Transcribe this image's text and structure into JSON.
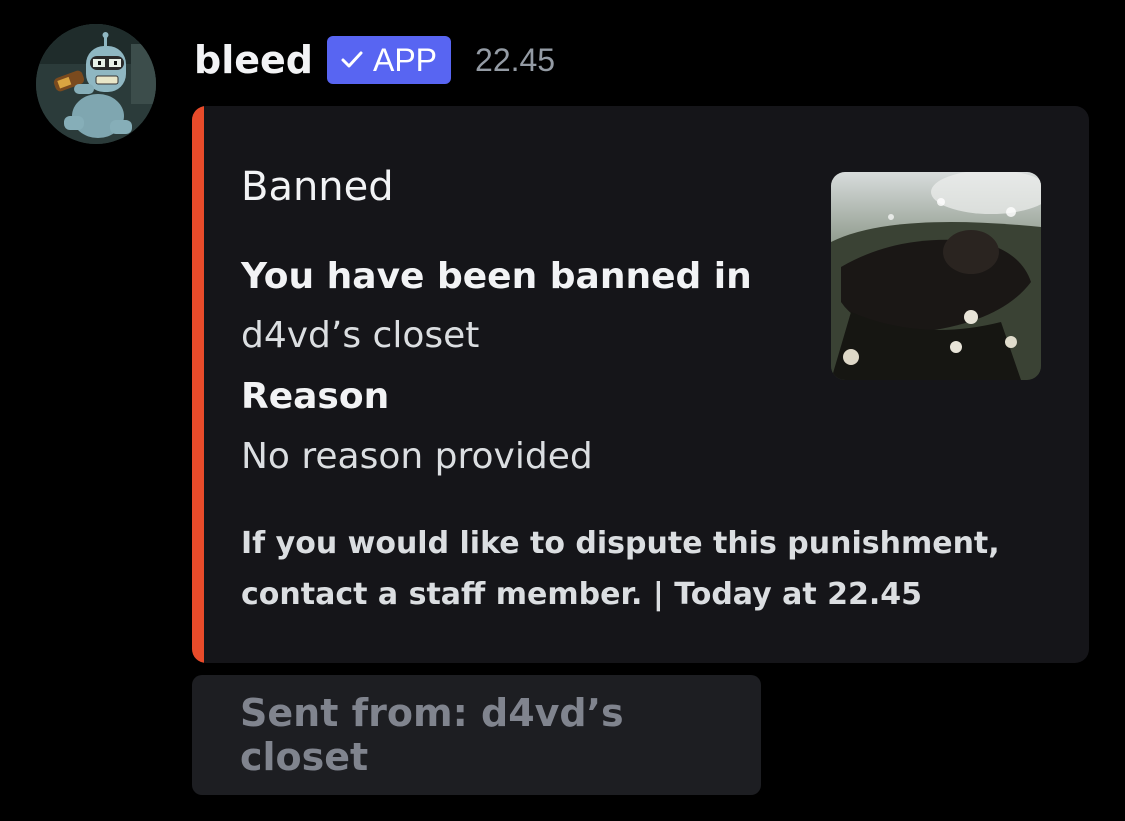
{
  "message": {
    "author": "bleed",
    "badge": "APP",
    "timestamp": "22.45"
  },
  "embed": {
    "accent_color": "#e84b2a",
    "title": "Banned",
    "fields": [
      {
        "name": "You have been banned in",
        "value": "d4vd’s closet"
      },
      {
        "name": "Reason",
        "value": "No reason provided"
      }
    ],
    "footer_line1": "If you would like to dispute this punishment,",
    "footer_line2": "contact a staff member. | Today at 22.45"
  },
  "sent_from": {
    "label": "Sent from: d4vd’s closet"
  },
  "icons": {
    "avatar": "robot-cartoon-avatar",
    "badge_check": "check-icon"
  },
  "colors": {
    "background": "#000000",
    "embed_bg": "#151519",
    "badge_bg": "#5865f2"
  }
}
